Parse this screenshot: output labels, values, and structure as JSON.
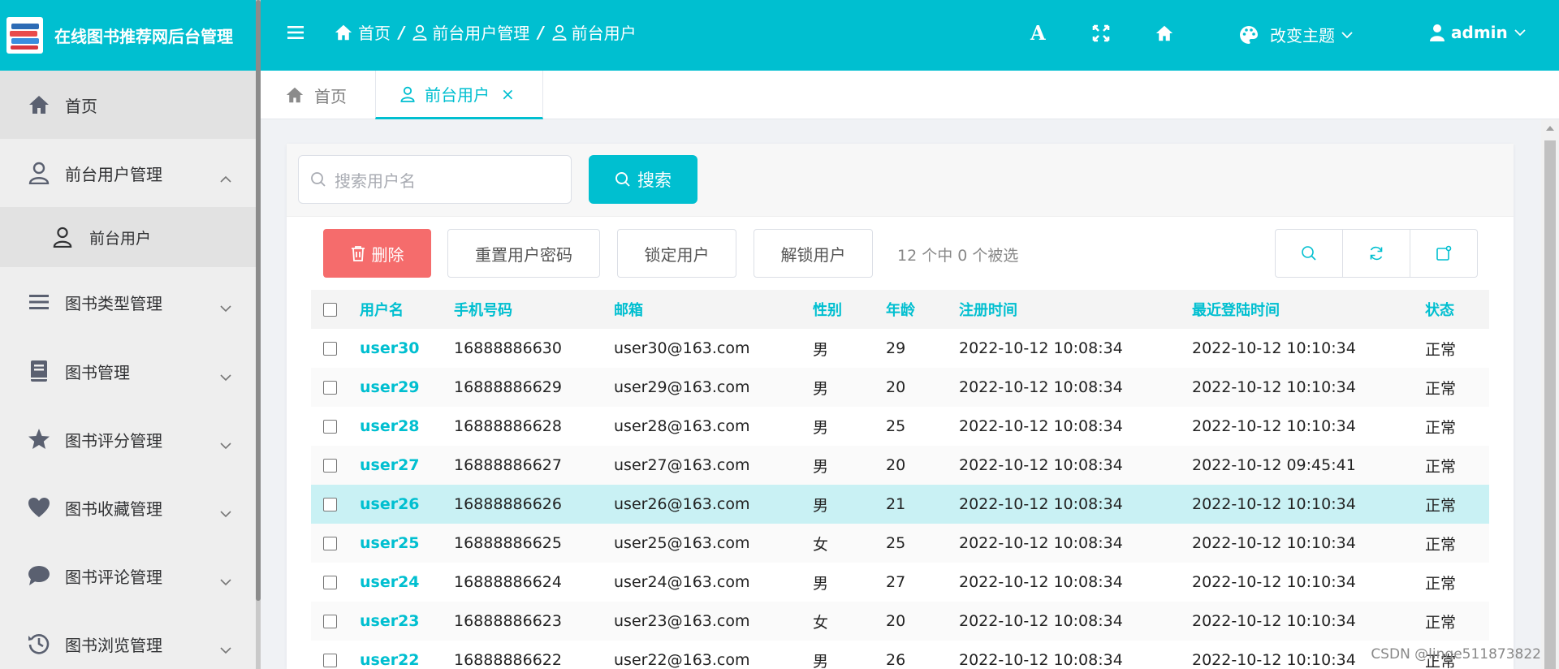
{
  "brand": {
    "title": "在线图书推荐网后台管理"
  },
  "sidebar": {
    "items": [
      {
        "label": "首页",
        "icon": "home-icon"
      },
      {
        "label": "前台用户管理",
        "icon": "user-icon",
        "expanded": true,
        "children": [
          {
            "label": "前台用户",
            "icon": "user-icon"
          }
        ]
      },
      {
        "label": "图书类型管理",
        "icon": "list-icon"
      },
      {
        "label": "图书管理",
        "icon": "book-icon"
      },
      {
        "label": "图书评分管理",
        "icon": "star-icon"
      },
      {
        "label": "图书收藏管理",
        "icon": "heart-icon"
      },
      {
        "label": "图书评论管理",
        "icon": "comment-icon"
      },
      {
        "label": "图书浏览管理",
        "icon": "history-icon"
      }
    ]
  },
  "header": {
    "breadcrumb": [
      "首页",
      "前台用户管理",
      "前台用户"
    ],
    "font_icon_text": "A",
    "theme_label": "改变主题",
    "user_name": "admin"
  },
  "tabs": [
    {
      "label": "首页",
      "active": false
    },
    {
      "label": "前台用户",
      "active": true,
      "close": "×"
    }
  ],
  "search": {
    "placeholder": "搜索用户名",
    "button_label": "搜索"
  },
  "toolbar": {
    "delete_label": "删除",
    "reset_password_label": "重置用户密码",
    "lock_label": "锁定用户",
    "unlock_label": "解锁用户",
    "selection_info": "12 个中 0 个被选"
  },
  "table": {
    "columns": [
      "用户名",
      "手机号码",
      "邮箱",
      "性别",
      "年龄",
      "注册时间",
      "最近登陆时间",
      "状态"
    ],
    "rows": [
      [
        "user30",
        "16888886630",
        "user30@163.com",
        "男",
        "29",
        "2022-10-12 10:08:34",
        "2022-10-12 10:10:34",
        "正常"
      ],
      [
        "user29",
        "16888886629",
        "user29@163.com",
        "男",
        "20",
        "2022-10-12 10:08:34",
        "2022-10-12 10:10:34",
        "正常"
      ],
      [
        "user28",
        "16888886628",
        "user28@163.com",
        "男",
        "25",
        "2022-10-12 10:08:34",
        "2022-10-12 10:10:34",
        "正常"
      ],
      [
        "user27",
        "16888886627",
        "user27@163.com",
        "男",
        "20",
        "2022-10-12 10:08:34",
        "2022-10-12 09:45:41",
        "正常"
      ],
      [
        "user26",
        "16888886626",
        "user26@163.com",
        "男",
        "21",
        "2022-10-12 10:08:34",
        "2022-10-12 10:10:34",
        "正常"
      ],
      [
        "user25",
        "16888886625",
        "user25@163.com",
        "女",
        "25",
        "2022-10-12 10:08:34",
        "2022-10-12 10:10:34",
        "正常"
      ],
      [
        "user24",
        "16888886624",
        "user24@163.com",
        "男",
        "27",
        "2022-10-12 10:08:34",
        "2022-10-12 10:10:34",
        "正常"
      ],
      [
        "user23",
        "16888886623",
        "user23@163.com",
        "女",
        "20",
        "2022-10-12 10:08:34",
        "2022-10-12 10:10:34",
        "正常"
      ],
      [
        "user22",
        "16888886622",
        "user22@163.com",
        "男",
        "26",
        "2022-10-12 10:08:34",
        "2022-10-12 10:10:34",
        "正常"
      ]
    ],
    "highlighted_row": 4
  },
  "watermark": "CSDN @linge511873822",
  "colors": {
    "primary": "#00bfd0",
    "danger": "#f56c6c",
    "sidebar_bg": "#eeeeee",
    "highlight_row": "#c9f1f4"
  }
}
